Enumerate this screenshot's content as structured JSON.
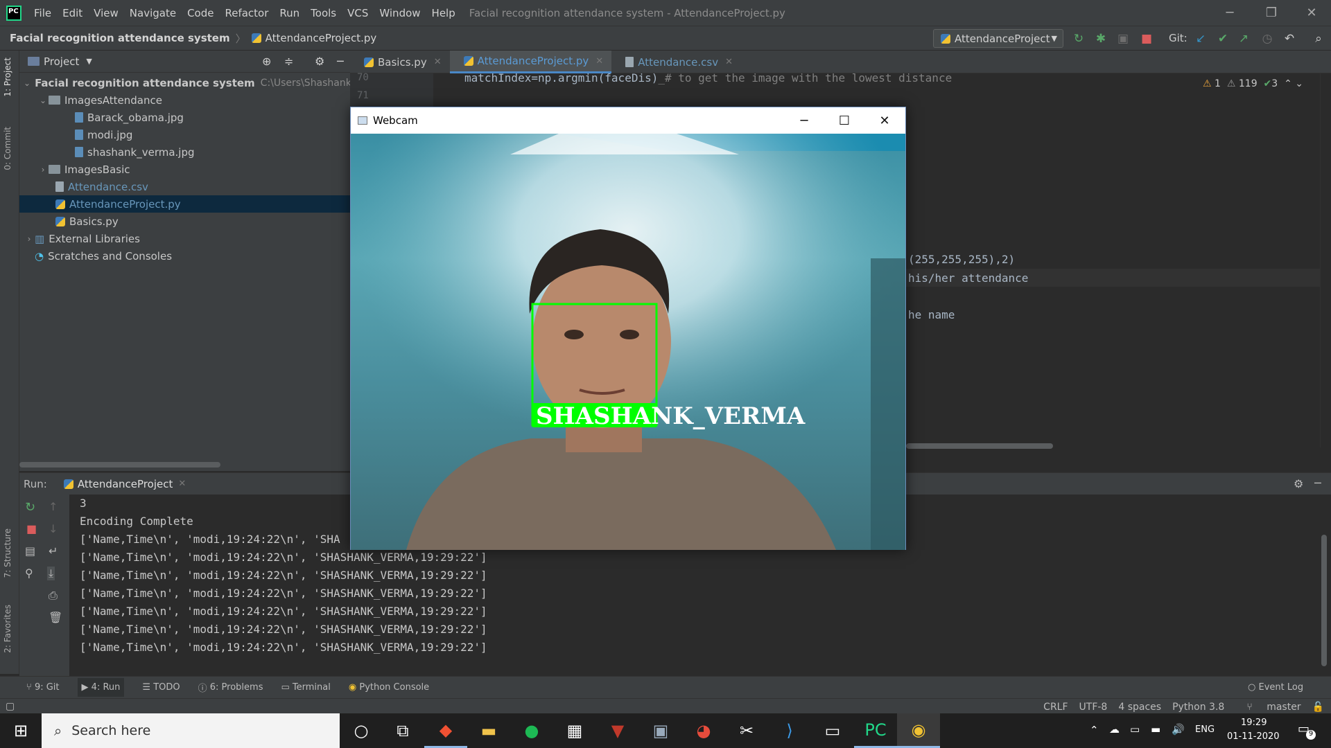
{
  "menu": {
    "items": [
      "File",
      "Edit",
      "View",
      "Navigate",
      "Code",
      "Refactor",
      "Run",
      "Tools",
      "VCS",
      "Window",
      "Help"
    ],
    "window_title": "Facial recognition attendance system - AttendanceProject.py"
  },
  "nav": {
    "project": "Facial recognition attendance system",
    "file": "AttendanceProject.py",
    "run_config": "AttendanceProject",
    "git_label": "Git:"
  },
  "project_panel": {
    "title": "Project",
    "root": "Facial recognition attendance system",
    "root_path": "C:\\Users\\Shashank Verma",
    "folder_attendance": "ImagesAttendance",
    "files_attendance": [
      "Barack_obama.jpg",
      "modi.jpg",
      "shashank_verma.jpg"
    ],
    "folder_basic": "ImagesBasic",
    "csv": "Attendance.csv",
    "selected": "AttendanceProject.py",
    "basics": "Basics.py",
    "ext_libs": "External Libraries",
    "scratches": "Scratches and Consoles"
  },
  "left_stripe": {
    "project_tab": "1: Project",
    "commit_tab": "0: Commit",
    "structure_tab": "7: Structure",
    "favorites_tab": "2: Favorites"
  },
  "editor": {
    "tabs": [
      "Basics.py",
      "AttendanceProject.py",
      "Attendance.csv"
    ],
    "line_numbers": [
      "70",
      "71"
    ],
    "line70_code": "matchIndex=np.argmin(faceDis)",
    "line70_comment": "_# to get the image with the lowest distance",
    "partial_color": "(255,255,255),2)",
    "partial_comment1": "his/her attendance",
    "partial_comment2": "he name",
    "inspections": {
      "warn1": "1",
      "warn2": "119",
      "ok": "3"
    }
  },
  "run": {
    "label": "Run:",
    "tab": "AttendanceProject",
    "lines": [
      "3",
      "Encoding Complete",
      "['Name,Time\\n', 'modi,19:24:22\\n', 'SHA",
      "['Name,Time\\n', 'modi,19:24:22\\n', 'SHASHANK_VERMA,19:29:22']",
      "['Name,Time\\n', 'modi,19:24:22\\n', 'SHASHANK_VERMA,19:29:22']",
      "['Name,Time\\n', 'modi,19:24:22\\n', 'SHASHANK_VERMA,19:29:22']",
      "['Name,Time\\n', 'modi,19:24:22\\n', 'SHASHANK_VERMA,19:29:22']",
      "['Name,Time\\n', 'modi,19:24:22\\n', 'SHASHANK_VERMA,19:29:22']",
      "['Name,Time\\n', 'modi,19:24:22\\n', 'SHASHANK_VERMA,19:29:22']"
    ]
  },
  "tool_tabs": [
    "9: Git",
    "4: Run",
    "TODO",
    "6: Problems",
    "Terminal",
    "Python Console"
  ],
  "event_log": "Event Log",
  "status": {
    "line_sep": "CRLF",
    "encoding": "UTF-8",
    "indent": "4 spaces",
    "interpreter": "Python 3.8",
    "branch": "master"
  },
  "webcam": {
    "title": "Webcam",
    "label": "SHASHANK_VERMA",
    "box_color": "#00ff00"
  },
  "taskbar": {
    "search_placeholder": "Search here",
    "lang": "ENG",
    "time": "19:29",
    "date": "01-11-2020",
    "notif_count": "9"
  }
}
